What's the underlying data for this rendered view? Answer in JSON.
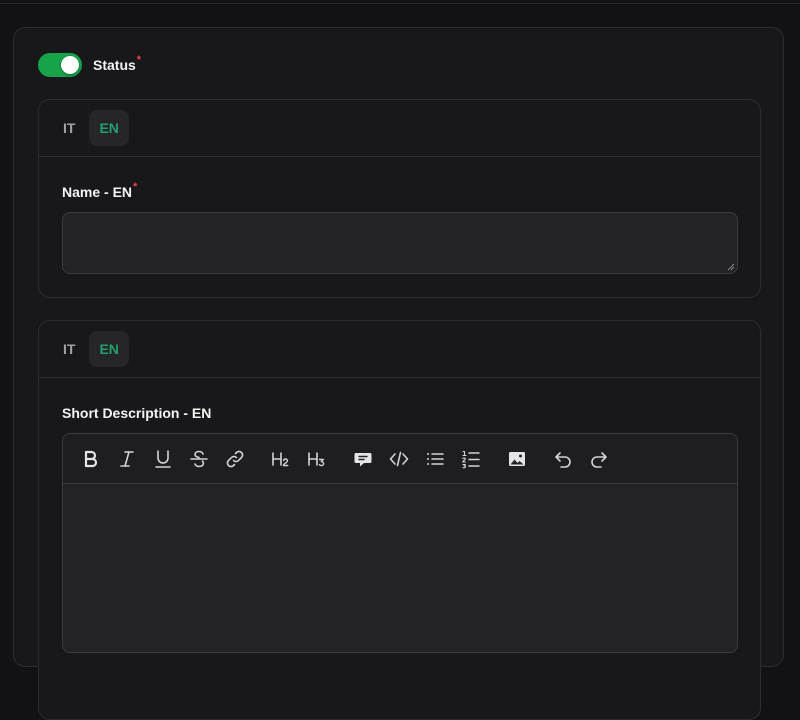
{
  "status": {
    "label": "Status",
    "required_mark": "*",
    "enabled": true,
    "toggle_color": "#16a34a"
  },
  "name_section": {
    "tabs": [
      {
        "label": "IT",
        "active": false
      },
      {
        "label": "EN",
        "active": true
      }
    ],
    "field_label": "Name - EN",
    "required_mark": "*",
    "value": ""
  },
  "description_section": {
    "tabs": [
      {
        "label": "IT",
        "active": false
      },
      {
        "label": "EN",
        "active": true
      }
    ],
    "field_label": "Short Description - EN",
    "value": "",
    "toolbar": [
      "bold-icon",
      "italic-icon",
      "underline-icon",
      "strikethrough-icon",
      "link-icon",
      "heading-2-icon",
      "heading-3-icon",
      "blockquote-icon",
      "code-block-icon",
      "bullet-list-icon",
      "ordered-list-icon",
      "image-icon",
      "undo-icon",
      "redo-icon"
    ]
  },
  "colors": {
    "accent_active_tab": "#22a06b",
    "required": "#ef4444",
    "background": "#18181b"
  }
}
